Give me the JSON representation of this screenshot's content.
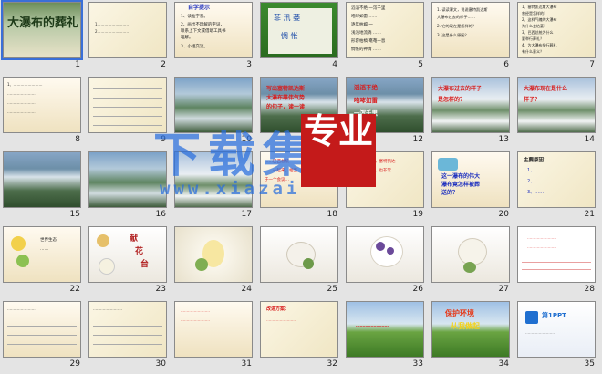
{
  "colors": {
    "background": "#e4e4e4",
    "selection": "#3a6fd8",
    "watermark_blue": "#286edc",
    "watermark_red": "#c41a1a",
    "slide_red_text": "#d81c1c",
    "slide_blue_text": "#1d2fbf"
  },
  "watermark": {
    "text": "下载集",
    "badge": "专业",
    "url": "www.xiazai"
  },
  "slides": [
    {
      "n": "1",
      "title": "大瀑布的葬礼"
    },
    {
      "n": "2",
      "lines": [
        "1. ……………………",
        "2. ……………………"
      ]
    },
    {
      "n": "3",
      "heading": "自学提示",
      "lines": [
        "1、读准字音。",
        "2、画出不理解的字词，",
        "联系上下文或借助工具书",
        "理解。",
        "3、小组交流。"
      ]
    },
    {
      "n": "4",
      "lines": [
        "菲 汛 萎",
        "惆 怅"
      ]
    },
    {
      "n": "5",
      "lines": [
        "滔滔不绝 一泻千里",
        "咆哮如雷 ……",
        "逐年枯竭 一",
        "浅浅地流淌 ……",
        "形容枯槁 奄奄一息",
        "惆怅的神情 ……"
      ]
    },
    {
      "n": "6",
      "lines": [
        "1. 读读课文，说说塞特凯达斯",
        "大瀑布过去的样子……",
        "2. 它的现在是怎样的？",
        "3. 这是什么原因？"
      ]
    },
    {
      "n": "7",
      "lines": [
        "1、塞特凯达斯大瀑布",
        "曾经是怎样的？",
        "2、这样气魄的大瀑布",
        "为什么会枯萎？",
        "3、巴西总统为什么",
        "要举行葬礼？",
        "4、为大瀑布举行葬礼",
        "有什么意义？"
      ]
    },
    {
      "n": "8",
      "lines": [
        "1、……………………",
        "……………………",
        "……………………",
        "……………………"
      ]
    },
    {
      "n": "9",
      "lines": []
    },
    {
      "n": "10",
      "lines": [
        "写出塞特凯达斯",
        "大瀑布雄伟气势",
        "的句子，读一读"
      ]
    },
    {
      "n": "11",
      "lines": [
        "滔滔不绝",
        "咆哮如雷",
        "一泻千里"
      ]
    },
    {
      "n": "12",
      "lines": [
        "大瀑布过去的样子",
        "是怎样的？"
      ]
    },
    {
      "n": "13",
      "lines": [
        "大瀑布现在是什么",
        "样子？"
      ]
    },
    {
      "n": "14",
      "lines": [
        "在飞流直下的高",
        "达几十米的大瀑布",
        "……"
      ]
    },
    {
      "n": "15",
      "lines": []
    },
    {
      "n": "16",
      "lines": []
    },
    {
      "n": "17",
      "lines": []
    },
    {
      "n": "18",
      "lines": [
        "……巴西总统",
        "……一起来，相当",
        "于一个会议…"
      ]
    },
    {
      "n": "19",
      "lines": [
        "……那个时候，塞特凯达",
        "斯大瀑布……，也非常",
        "壮观……"
      ]
    },
    {
      "n": "20",
      "lines": [
        "这一瀑布的伟大",
        "瀑布竟怎样被葬",
        "送的？"
      ]
    },
    {
      "n": "21",
      "lines": [
        "主要原因：",
        "1、……",
        "2、……",
        "3、……"
      ]
    },
    {
      "n": "22",
      "lines": [
        "世界生态",
        "……"
      ]
    },
    {
      "n": "23",
      "lines": [
        "献",
        "花",
        "台"
      ]
    },
    {
      "n": "24",
      "lines": []
    },
    {
      "n": "25",
      "lines": []
    },
    {
      "n": "26",
      "lines": []
    },
    {
      "n": "27",
      "lines": []
    },
    {
      "n": "28",
      "lines": [
        "……………………",
        "……………………"
      ]
    },
    {
      "n": "29",
      "lines": [
        "……………………",
        "……………………"
      ]
    },
    {
      "n": "30",
      "lines": [
        "……………………",
        "……………………"
      ]
    },
    {
      "n": "31",
      "lines": [
        "……………………",
        "……………………"
      ]
    },
    {
      "n": "32",
      "lines": [
        "改进方案：",
        "……………………"
      ]
    },
    {
      "n": "33",
      "lines": [
        "……………………"
      ]
    },
    {
      "n": "34",
      "lines": [
        "保护环境",
        "从我做起"
      ]
    },
    {
      "n": "35",
      "lines": [
        "第1PPT",
        "……………………"
      ]
    }
  ]
}
